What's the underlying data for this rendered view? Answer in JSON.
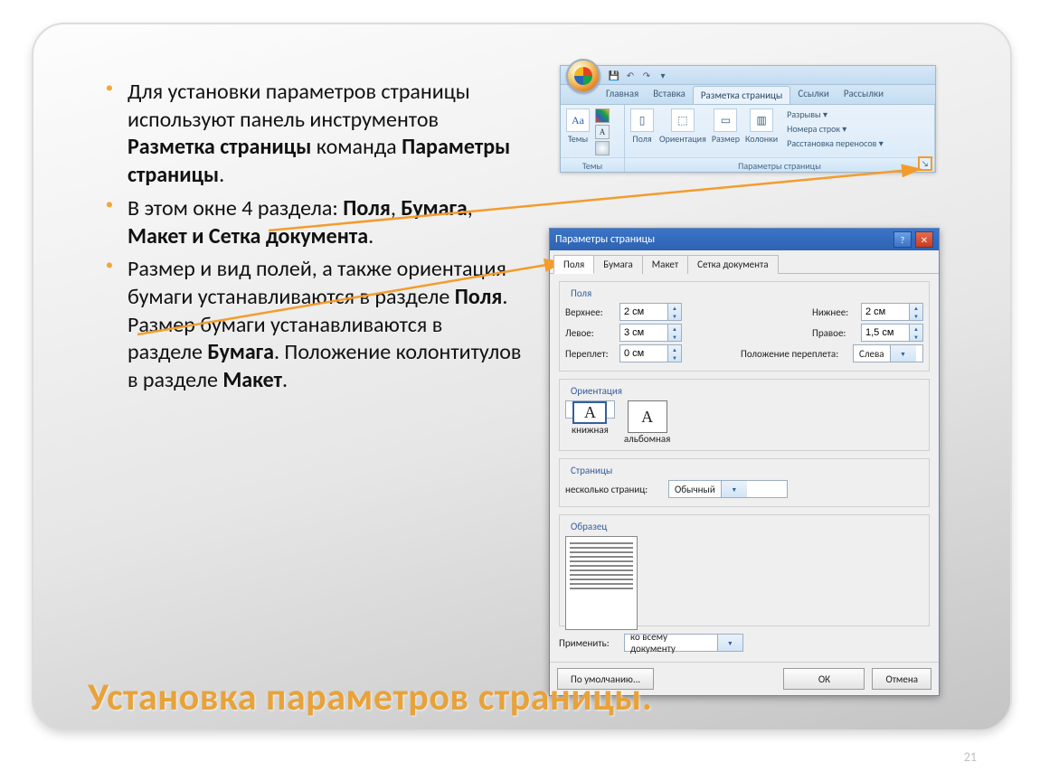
{
  "slide": {
    "title": "Установка параметров страницы.",
    "page_number": "21",
    "bullets": [
      {
        "pre": "Для установки параметров страницы используют панель инструментов ",
        "b1": "Разметка страницы",
        "mid": " команда ",
        "b2": "Параметры страницы",
        "post": "."
      },
      {
        "pre": "В этом окне 4 раздела: ",
        "b1": "Поля",
        "mid": ", ",
        "b2": "Бумага",
        "mid2": ", ",
        "b3": "Макет и Сетка документа",
        "post": "."
      },
      {
        "pre": "Размер и вид полей, а также ориентация бумаги устанавливаются в разделе ",
        "b1": "Поля",
        "mid": ". Размер бумаги устанавливаются в разделе ",
        "b2": "Бумага",
        "mid2": ". Положение колонтитулов в разделе ",
        "b3": "Макет",
        "post": "."
      }
    ]
  },
  "ribbon": {
    "qat_icons": [
      "save",
      "undo",
      "redo",
      "dd"
    ],
    "tabs": [
      "Главная",
      "Вставка",
      "Разметка страницы",
      "Ссылки",
      "Рассылки"
    ],
    "active_tab": "Разметка страницы",
    "group_themes": {
      "label": "Темы",
      "btn": "Темы"
    },
    "group_page": {
      "label": "Параметры страницы",
      "items": [
        "Поля",
        "Ориентация",
        "Размер",
        "Колонки"
      ],
      "side": [
        "Разрывы ▾",
        "Номера строк ▾",
        "Расстановка переносов ▾"
      ]
    }
  },
  "dialog": {
    "title": "Параметры страницы",
    "tabs": [
      "Поля",
      "Бумага",
      "Макет",
      "Сетка документа"
    ],
    "active_tab": "Поля",
    "section_margins": {
      "title": "Поля",
      "top_lbl": "Верхнее:",
      "top_val": "2 см",
      "bottom_lbl": "Нижнее:",
      "bottom_val": "2 см",
      "left_lbl": "Левое:",
      "left_val": "3 см",
      "right_lbl": "Правое:",
      "right_val": "1,5 см",
      "gutter_lbl": "Переплет:",
      "gutter_val": "0 см",
      "gutter_pos_lbl": "Положение переплета:",
      "gutter_pos_val": "Слева"
    },
    "section_orient": {
      "title": "Ориентация",
      "portrait": "книжная",
      "landscape": "альбомная"
    },
    "section_pages": {
      "title": "Страницы",
      "lbl": "несколько страниц:",
      "val": "Обычный"
    },
    "section_preview": {
      "title": "Образец"
    },
    "apply_lbl": "Применить:",
    "apply_val": "ко всему документу",
    "btn_default": "По умолчанию...",
    "btn_ok": "ОК",
    "btn_cancel": "Отмена"
  }
}
